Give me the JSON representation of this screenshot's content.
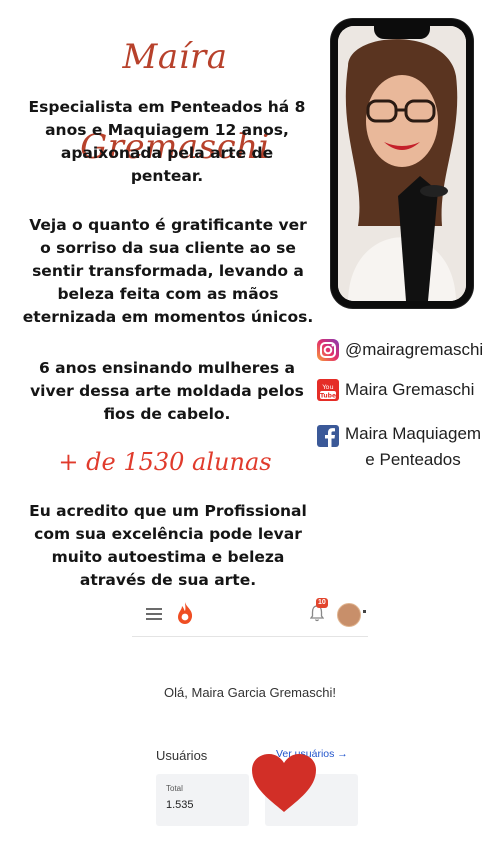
{
  "title": "Maíra Gremaschi",
  "intro": [
    "Especialista em Penteados há 8",
    "anos e Maquiagem 12 anos,",
    "apaixonada pela arte de",
    "pentear."
  ],
  "gratifying": [
    "Veja o quanto é gratificante ver",
    "o sorriso da sua cliente ao se",
    "sentir transformada, levando a",
    "beleza feita com as mãos",
    "eternizada em momentos únicos."
  ],
  "teaching": [
    "6 anos ensinando mulheres a",
    "viver dessa arte moldada pelos",
    "fios de cabelo."
  ],
  "students": "+ de 1530 alunas",
  "belief": [
    "Eu acredito que um Profissional",
    "com sua excelência pode levar",
    "muito autoestima e beleza",
    "através de sua arte."
  ],
  "social": {
    "instagram": "@mairagremaschi",
    "youtube": "Maira Gremaschi",
    "facebook_line1": "Maira Maquiagem",
    "facebook_line2": "e Penteados"
  },
  "app": {
    "notification_count": "10",
    "greeting": "Olá, Maira Garcia Gremaschi!",
    "users_title": "Usuários",
    "users_link": "Ver usuários →",
    "card_total_label": "Total",
    "card_total_value": "1.535"
  },
  "colors": {
    "title": "#b7412b",
    "students": "#e03b2c",
    "heart": "#d22f27",
    "facebook": "#3b5998",
    "youtube": "#e52d27"
  }
}
